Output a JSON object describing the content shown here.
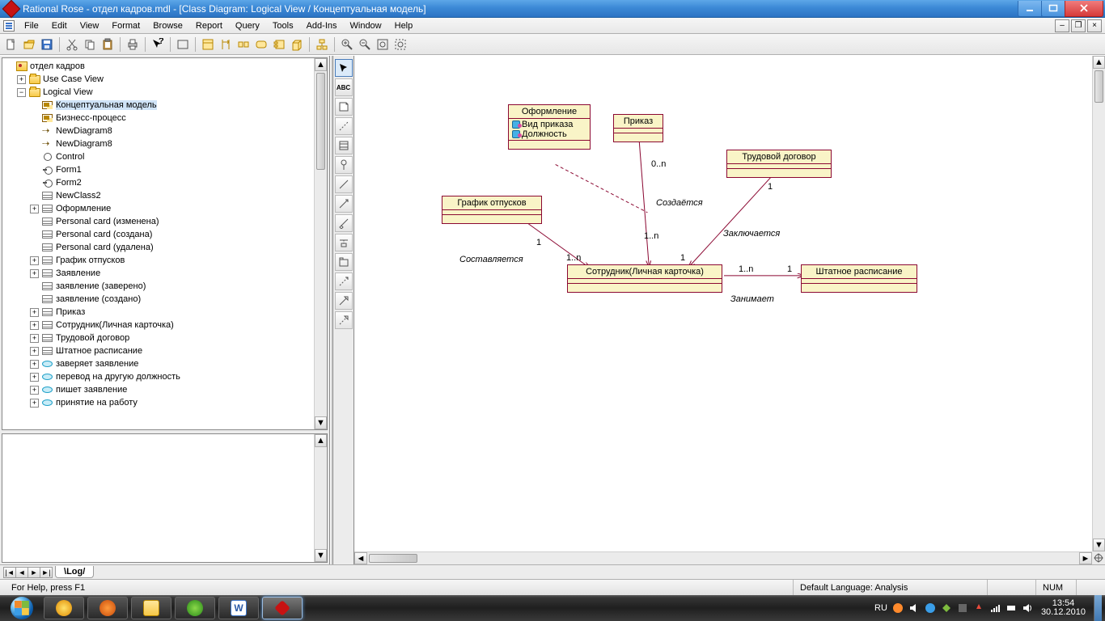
{
  "title": "Rational Rose - отдел кадров.mdl - [Class Diagram: Logical View / Концептуальная модель]",
  "menu": [
    "File",
    "Edit",
    "View",
    "Format",
    "Browse",
    "Report",
    "Query",
    "Tools",
    "Add-Ins",
    "Window",
    "Help"
  ],
  "tree": {
    "root": "отдел кадров",
    "usecase": "Use Case View",
    "logical": "Logical View",
    "items": [
      {
        "t": "diag",
        "l": "Концептуальная модель",
        "sel": true
      },
      {
        "t": "diag",
        "l": "Бизнесс-процесс"
      },
      {
        "t": "seq",
        "l": "NewDiagram8"
      },
      {
        "t": "seq",
        "l": "NewDiagram8"
      },
      {
        "t": "circ",
        "l": "Control"
      },
      {
        "t": "lolly",
        "l": "Form1"
      },
      {
        "t": "lolly",
        "l": "Form2"
      },
      {
        "t": "cls",
        "l": "NewClass2"
      },
      {
        "t": "cls",
        "l": "Оформление",
        "exp": true
      },
      {
        "t": "cls",
        "l": "Personal card (изменена)"
      },
      {
        "t": "cls",
        "l": "Personal card (создана)"
      },
      {
        "t": "cls",
        "l": "Personal card (удалена)"
      },
      {
        "t": "cls",
        "l": "График отпусков",
        "exp": true
      },
      {
        "t": "cls",
        "l": "Заявление",
        "exp": true
      },
      {
        "t": "cls",
        "l": "заявление (заверено)"
      },
      {
        "t": "cls",
        "l": "заявление (создано)"
      },
      {
        "t": "cls",
        "l": "Приказ",
        "exp": true
      },
      {
        "t": "cls",
        "l": "Сотрудник(Личная карточка)",
        "exp": true
      },
      {
        "t": "cls",
        "l": "Трудовой договор",
        "exp": true
      },
      {
        "t": "cls",
        "l": "Штатное расписание",
        "exp": true
      },
      {
        "t": "oval",
        "l": "заверяет заявление",
        "exp": true
      },
      {
        "t": "oval",
        "l": "перевод на другую должность",
        "exp": true
      },
      {
        "t": "oval",
        "l": "пишет заявление",
        "exp": true
      },
      {
        "t": "oval",
        "l": "принятие на работу",
        "exp": true
      }
    ]
  },
  "toolbox_abc": "ABC",
  "diagram": {
    "classes": {
      "oformlenie": {
        "name": "Оформление",
        "attrs": [
          "Вид приказа",
          "Должность"
        ]
      },
      "prikaz": {
        "name": "Приказ"
      },
      "trudovoi": {
        "name": "Трудовой договор"
      },
      "grafik": {
        "name": "График отпусков"
      },
      "sotrudnik": {
        "name": "Сотрудник(Личная карточка)"
      },
      "shtatnoe": {
        "name": "Штатное расписание"
      }
    },
    "labels": {
      "sozdaetsya": "Создаётся",
      "zaklyuchaetsya": "Заключается",
      "sostavlyaetsya": "Составляется",
      "zanimaet": "Занимает"
    },
    "mult": {
      "m0n": "0..n",
      "m1": "1",
      "m1n": "1..n"
    }
  },
  "tab": "Log",
  "status": {
    "help": "For Help, press F1",
    "lang": "Default Language: Analysis",
    "num": "NUM"
  },
  "tray": {
    "lang": "RU",
    "time": "13:54",
    "date": "30.12.2010"
  }
}
